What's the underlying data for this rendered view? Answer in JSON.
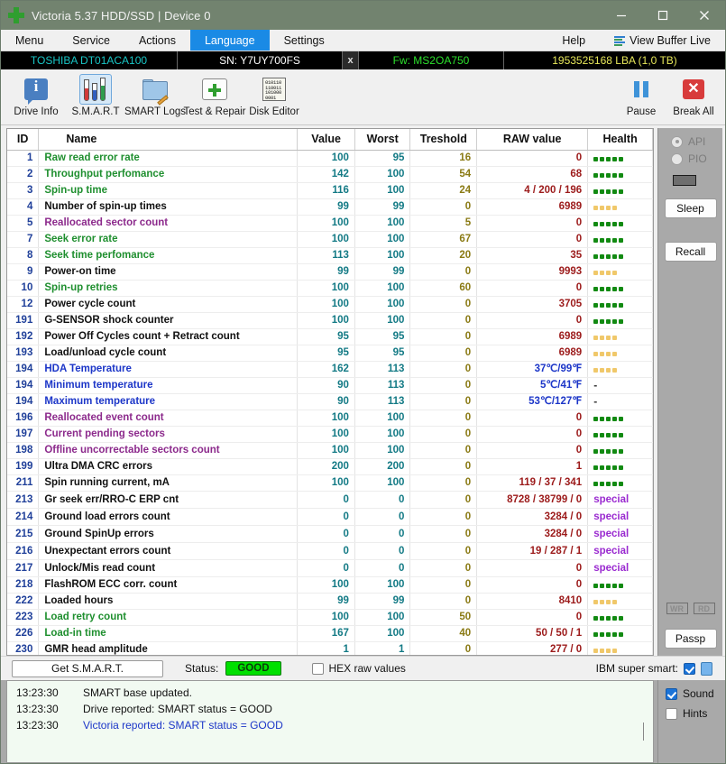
{
  "window": {
    "title": "Victoria 5.37 HDD/SSD | Device 0",
    "minimize": "–",
    "maximize": "□",
    "close": "✕"
  },
  "menubar": {
    "items": [
      {
        "label": "Menu",
        "active": false
      },
      {
        "label": "Service",
        "active": false
      },
      {
        "label": "Actions",
        "active": false
      },
      {
        "label": "Language",
        "active": true
      },
      {
        "label": "Settings",
        "active": false
      }
    ],
    "help": "Help",
    "view_buffer": "View Buffer Live"
  },
  "infobar": {
    "model": "TOSHIBA DT01ACA100",
    "serial": "SN: Y7UY700FS",
    "x": "x",
    "firmware": "Fw: MS2OA750",
    "capacity": "1953525168 LBA (1,0 TB)"
  },
  "toolbar": {
    "left": [
      {
        "label": "Drive Info",
        "icon": "info-icon",
        "selected": false
      },
      {
        "label": "S.M.A.R.T",
        "icon": "test-tubes-icon",
        "selected": true
      },
      {
        "label": "SMART Logs",
        "icon": "folder-pencil-icon",
        "selected": false
      },
      {
        "label": "Test & Repair",
        "icon": "first-aid-kit-icon",
        "selected": false
      },
      {
        "label": "Disk Editor",
        "icon": "binary-document-icon",
        "selected": false
      }
    ],
    "right": [
      {
        "label": "Pause",
        "icon": "pause-icon"
      },
      {
        "label": "Break All",
        "icon": "break-all-icon"
      }
    ]
  },
  "table": {
    "headers": [
      "ID",
      "Name",
      "Value",
      "Worst",
      "Treshold",
      "RAW value",
      "Health"
    ],
    "rows": [
      {
        "id": "1",
        "name": "Raw read error rate",
        "color": "nm-green",
        "value": "100",
        "worst": "95",
        "thr": "16",
        "raw": "0",
        "health": "g5"
      },
      {
        "id": "2",
        "name": "Throughput perfomance",
        "color": "nm-green",
        "value": "142",
        "worst": "100",
        "thr": "54",
        "raw": "68",
        "health": "g5"
      },
      {
        "id": "3",
        "name": "Spin-up time",
        "color": "nm-green",
        "value": "116",
        "worst": "100",
        "thr": "24",
        "raw": "4 / 200 / 196",
        "health": "g5"
      },
      {
        "id": "4",
        "name": "Number of spin-up times",
        "color": "nm-black",
        "value": "99",
        "worst": "99",
        "thr": "0",
        "raw": "6989",
        "health": "o4"
      },
      {
        "id": "5",
        "name": "Reallocated sector count",
        "color": "nm-purple",
        "value": "100",
        "worst": "100",
        "thr": "5",
        "raw": "0",
        "health": "g5"
      },
      {
        "id": "7",
        "name": "Seek error rate",
        "color": "nm-green",
        "value": "100",
        "worst": "100",
        "thr": "67",
        "raw": "0",
        "health": "g5"
      },
      {
        "id": "8",
        "name": "Seek time perfomance",
        "color": "nm-green",
        "value": "113",
        "worst": "100",
        "thr": "20",
        "raw": "35",
        "health": "g5"
      },
      {
        "id": "9",
        "name": "Power-on time",
        "color": "nm-black",
        "value": "99",
        "worst": "99",
        "thr": "0",
        "raw": "9993",
        "health": "o4"
      },
      {
        "id": "10",
        "name": "Spin-up retries",
        "color": "nm-green",
        "value": "100",
        "worst": "100",
        "thr": "60",
        "raw": "0",
        "health": "g5"
      },
      {
        "id": "12",
        "name": "Power cycle count",
        "color": "nm-black",
        "value": "100",
        "worst": "100",
        "thr": "0",
        "raw": "3705",
        "health": "g5"
      },
      {
        "id": "191",
        "name": "G-SENSOR shock counter",
        "color": "nm-black",
        "value": "100",
        "worst": "100",
        "thr": "0",
        "raw": "0",
        "health": "g5"
      },
      {
        "id": "192",
        "name": "Power Off Cycles count + Retract count",
        "color": "nm-black",
        "value": "95",
        "worst": "95",
        "thr": "0",
        "raw": "6989",
        "health": "o4"
      },
      {
        "id": "193",
        "name": "Load/unload cycle count",
        "color": "nm-black",
        "value": "95",
        "worst": "95",
        "thr": "0",
        "raw": "6989",
        "health": "o4"
      },
      {
        "id": "194",
        "name": "HDA Temperature",
        "color": "nm-blue",
        "value": "162",
        "worst": "113",
        "thr": "0",
        "raw": "37℃/99℉",
        "health": "o4",
        "rawcolor": "blue"
      },
      {
        "id": "194",
        "name": "Minimum temperature",
        "color": "nm-blue",
        "value": "90",
        "worst": "113",
        "thr": "0",
        "raw": "5℃/41℉",
        "health": "dash",
        "rawcolor": "blue"
      },
      {
        "id": "194",
        "name": "Maximum temperature",
        "color": "nm-blue",
        "value": "90",
        "worst": "113",
        "thr": "0",
        "raw": "53℃/127℉",
        "health": "dash",
        "rawcolor": "blue"
      },
      {
        "id": "196",
        "name": "Reallocated event count",
        "color": "nm-purple",
        "value": "100",
        "worst": "100",
        "thr": "0",
        "raw": "0",
        "health": "g5"
      },
      {
        "id": "197",
        "name": "Current pending sectors",
        "color": "nm-purple",
        "value": "100",
        "worst": "100",
        "thr": "0",
        "raw": "0",
        "health": "g5"
      },
      {
        "id": "198",
        "name": "Offline uncorrectable sectors count",
        "color": "nm-purple",
        "value": "100",
        "worst": "100",
        "thr": "0",
        "raw": "0",
        "health": "g5"
      },
      {
        "id": "199",
        "name": "Ultra DMA CRC errors",
        "color": "nm-black",
        "value": "200",
        "worst": "200",
        "thr": "0",
        "raw": "1",
        "health": "g5"
      },
      {
        "id": "211",
        "name": "Spin running current, mA",
        "color": "nm-black",
        "value": "100",
        "worst": "100",
        "thr": "0",
        "raw": "119 / 37 / 341",
        "health": "g5"
      },
      {
        "id": "213",
        "name": "Gr seek err/RRO-C ERP cnt",
        "color": "nm-black",
        "value": "0",
        "worst": "0",
        "thr": "0",
        "raw": "8728 / 38799 / 0",
        "health": "special"
      },
      {
        "id": "214",
        "name": "Ground load errors count",
        "color": "nm-black",
        "value": "0",
        "worst": "0",
        "thr": "0",
        "raw": "3284 / 0",
        "health": "special"
      },
      {
        "id": "215",
        "name": "Ground SpinUp errors",
        "color": "nm-black",
        "value": "0",
        "worst": "0",
        "thr": "0",
        "raw": "3284 / 0",
        "health": "special"
      },
      {
        "id": "216",
        "name": "Unexpectant errors count",
        "color": "nm-black",
        "value": "0",
        "worst": "0",
        "thr": "0",
        "raw": "19 / 287 / 1",
        "health": "special"
      },
      {
        "id": "217",
        "name": "Unlock/Mis read count",
        "color": "nm-black",
        "value": "0",
        "worst": "0",
        "thr": "0",
        "raw": "0",
        "health": "special"
      },
      {
        "id": "218",
        "name": "FlashROM ECC corr. count",
        "color": "nm-black",
        "value": "100",
        "worst": "100",
        "thr": "0",
        "raw": "0",
        "health": "g5"
      },
      {
        "id": "222",
        "name": "Loaded hours",
        "color": "nm-black",
        "value": "99",
        "worst": "99",
        "thr": "0",
        "raw": "8410",
        "health": "o4"
      },
      {
        "id": "223",
        "name": "Load retry count",
        "color": "nm-green",
        "value": "100",
        "worst": "100",
        "thr": "50",
        "raw": "0",
        "health": "g5"
      },
      {
        "id": "226",
        "name": "Load-in time",
        "color": "nm-green",
        "value": "167",
        "worst": "100",
        "thr": "40",
        "raw": "50 / 50 / 1",
        "health": "g5"
      },
      {
        "id": "230",
        "name": "GMR head amplitude",
        "color": "nm-black",
        "value": "1",
        "worst": "1",
        "thr": "0",
        "raw": "277 / 0",
        "health": "o4"
      }
    ]
  },
  "sidepanel": {
    "api_label": "API",
    "pio_label": "PIO",
    "sleep_label": "Sleep",
    "recall_label": "Recall",
    "wr_label": "WR",
    "rd_label": "RD",
    "passp_label": "Passp"
  },
  "statusbar": {
    "get_smart": "Get S.M.A.R.T.",
    "status_label": "Status:",
    "status_value": "GOOD",
    "hex_label": "HEX raw values",
    "hex_checked": false,
    "ibm_label": "IBM super smart:",
    "ibm_checked": true
  },
  "log": {
    "lines": [
      {
        "time": "13:23:30",
        "msg": "SMART base updated.",
        "style": "black"
      },
      {
        "time": "13:23:30",
        "msg": "Drive reported: SMART status = GOOD",
        "style": "black"
      },
      {
        "time": "13:23:30",
        "msg": "Victoria reported: SMART status = GOOD",
        "style": "blue"
      }
    ]
  },
  "logside": {
    "sound_label": "Sound",
    "sound_checked": true,
    "hints_label": "Hints",
    "hints_checked": false
  },
  "colors": {
    "accent_blue": "#1a8ae5",
    "good_green": "#00e000",
    "titlebar": "#72836f"
  }
}
